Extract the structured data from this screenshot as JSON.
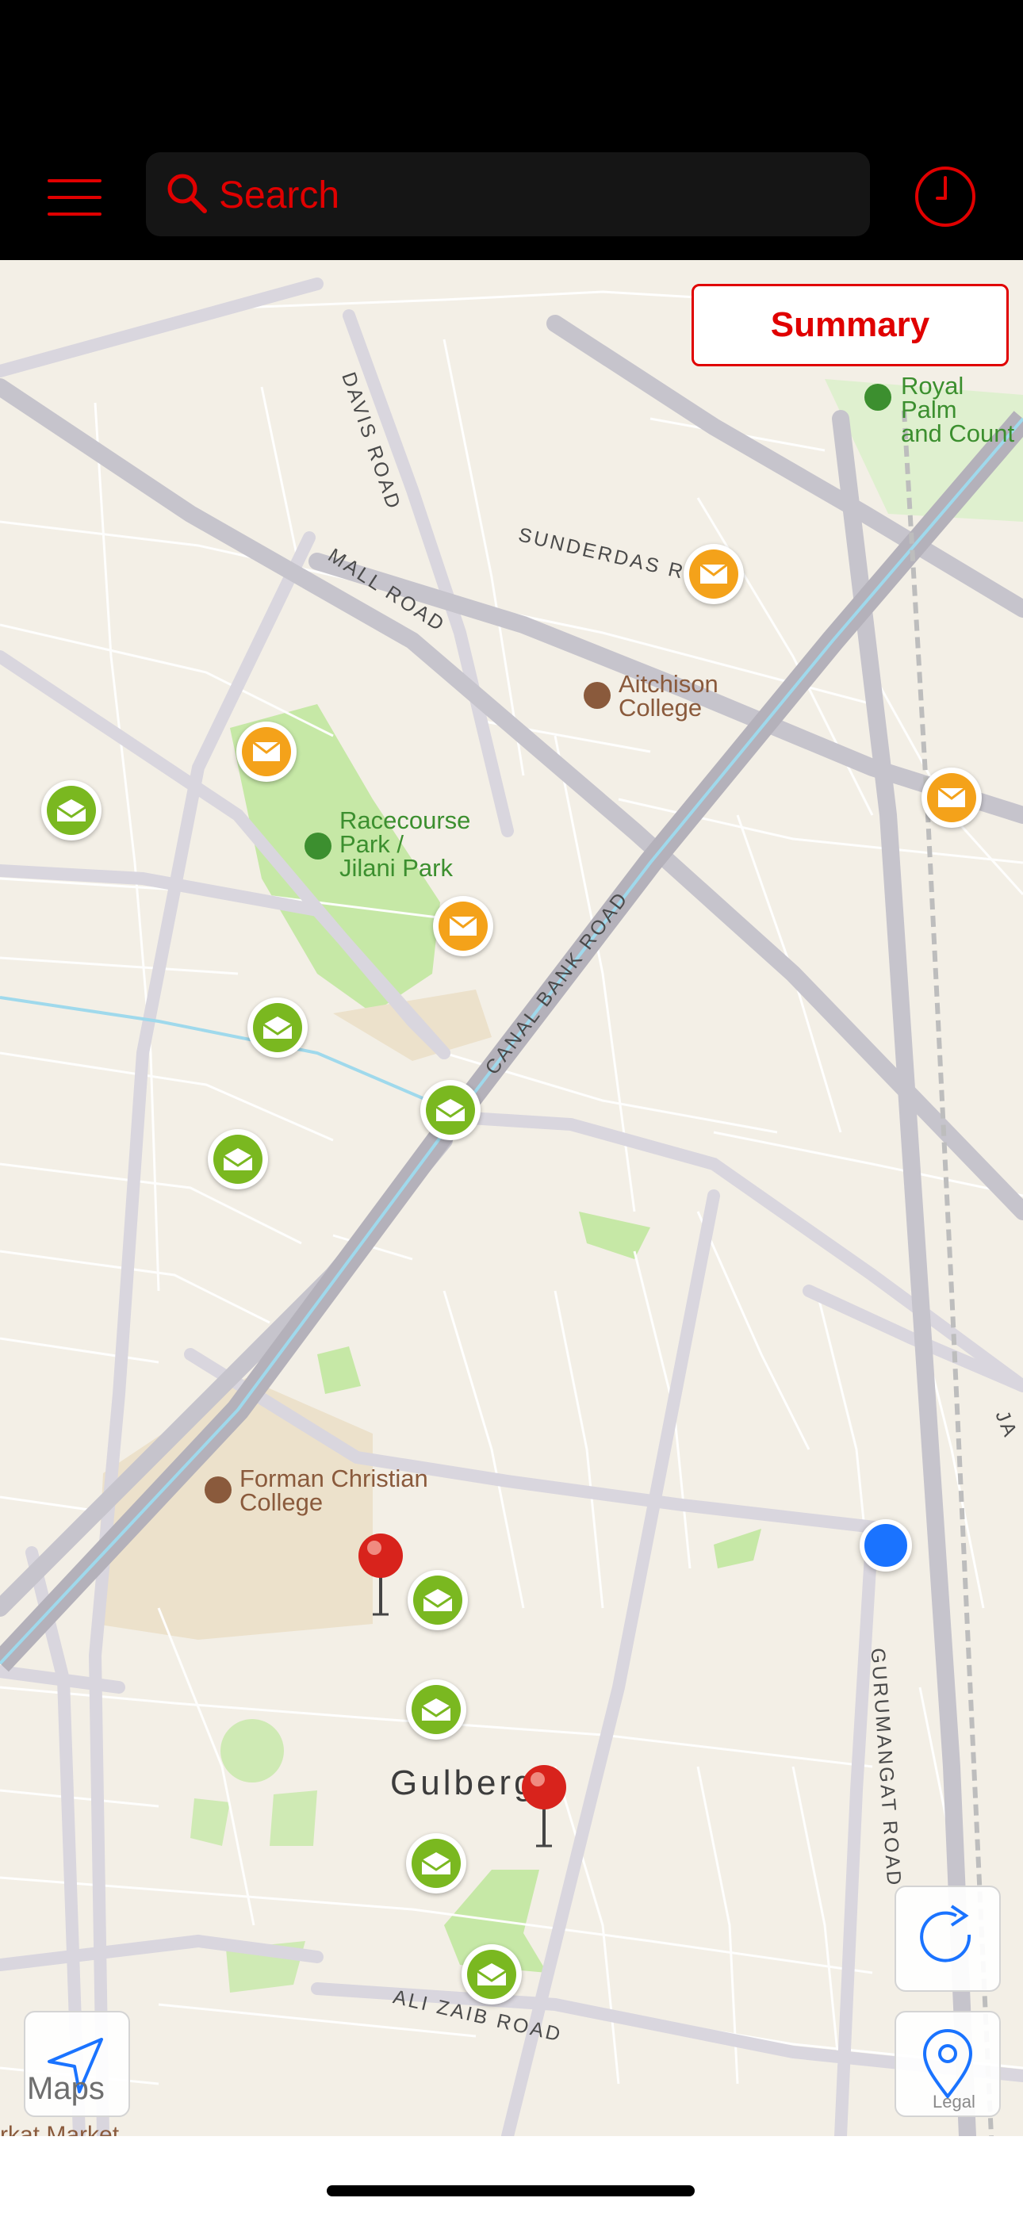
{
  "search": {
    "placeholder": "Search"
  },
  "map": {
    "summary_label": "Summary",
    "road_labels": {
      "davis_road": "DAVIS ROAD",
      "sunderdas_road": "SUNDERDAS RO",
      "mall_road": "MALL ROAD",
      "canal_bank_road": "CANAL BANK ROAD",
      "gurumangat_road": "GURUMANGAT ROAD",
      "ali_zaib_road": "ALI ZAIB ROAD",
      "cut_road": "JA"
    },
    "poi_labels": {
      "royal_palm_1": "Royal Palm",
      "royal_palm_2": "and Count",
      "aitchison_1": "Aitchison",
      "aitchison_2": "College",
      "racecourse_1": "Racecourse",
      "racecourse_2": "Park /",
      "racecourse_3": "Jilani Park",
      "forman_1": "Forman Christian",
      "forman_2": "College"
    },
    "area_label": "Gulberg",
    "maps_logo": "Maps",
    "legal": "Legal",
    "cut_label": "rkat Market"
  },
  "colors": {
    "accent": "#e00000",
    "marker_green": "#7ab820",
    "marker_orange": "#f4a21a",
    "user_location": "#1a73ff",
    "park": "#c6e8a6",
    "map_bg": "#f3efe6"
  },
  "icons": [
    "menu-icon",
    "search-icon",
    "history-icon",
    "envelope-icon",
    "pushpin-icon",
    "refresh-icon",
    "location-pin-icon",
    "navigation-arrow-icon"
  ]
}
